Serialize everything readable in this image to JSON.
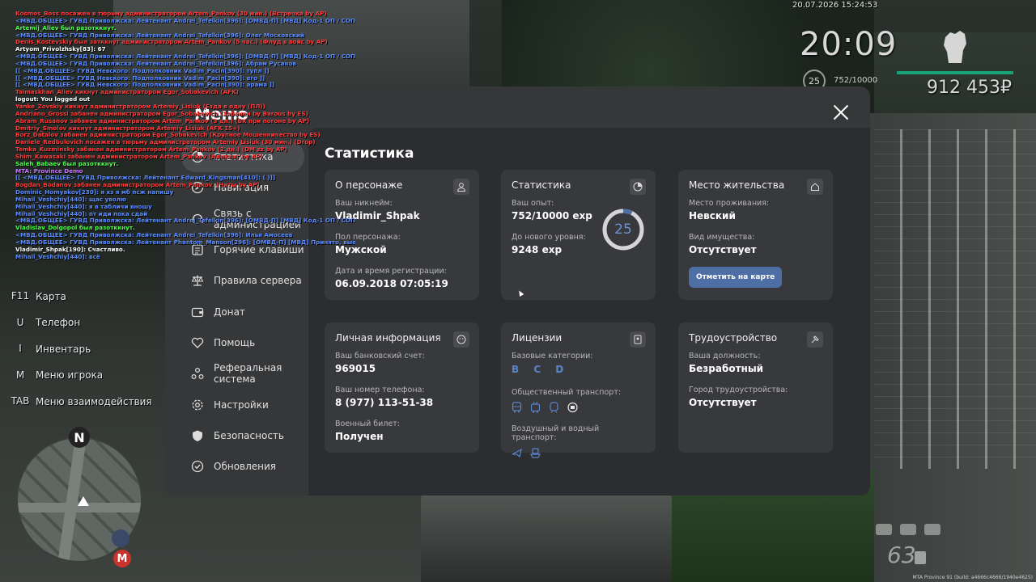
{
  "timestamp": "20.07.2026 15:24:53",
  "chat": [
    {
      "text": "Kosmos_Boss посажен в тюрьму администратором Artem_Pankov (30 мин.) (Встречка by AP)",
      "color": "#ff3b3b"
    },
    {
      "text": "<МВД.ОБЩЕЕ> ГУВД Приволжска: Лейтенант Andrei_Tefelkin[396]: [ОМВД-П] [МВД] Код-1 ОП / СОП по БД:",
      "color": "#5b8cff"
    },
    {
      "text": "Artemij_Aliev был разотккнут.",
      "color": "#4cff4c"
    },
    {
      "text": "<МВД.ОБЩЕЕ> ГУВД Приволжска: Лейтенант Andrei_Tefelkin[396]: Олег Московский",
      "color": "#5b8cff"
    },
    {
      "text": "Denis_Kostevskiy был затккнут администратором Artem_Pankov (5 час.) (Флуд в войс by AP)",
      "color": "#ff3b3b"
    },
    {
      "text": "Artyom_Privolzhsky[83]: 67",
      "color": "#ffffff"
    },
    {
      "text": "<МВД.ОБЩЕЕ> ГУВД Приволжска: Лейтенант Andrei_Tefelkin[396]: [ОМВД-П] [МВД] Код-1 ОП / СОП по БД:",
      "color": "#5b8cff"
    },
    {
      "text": "<МВД.ОБЩЕЕ> ГУВД Приволжска: Лейтенант Andrei_Tefelkin[396]: Абрам Русанов",
      "color": "#5b8cff"
    },
    {
      "text": "[[ <МВД.ОБЩЕЕ> ГУВД Невского: Подполковник Vadim_Pacin[390]: тупл ]]",
      "color": "#5b8cff"
    },
    {
      "text": "[[ <МВД.ОБЩЕЕ> ГУВД Невского: Подполковник Vadim_Pacin[390]: его ]]",
      "color": "#5b8cff"
    },
    {
      "text": "[[ <МВД.ОБЩЕЕ> ГУВД Невского: Подполковник Vadim_Pacin[390]: арама ]]",
      "color": "#5b8cff"
    },
    {
      "text": "Taimaskhan_Aliev кикнут администратором Egor_Sobakevich (AFK)",
      "color": "#ff3b3b"
    },
    {
      "text": "logout: You logged out",
      "color": "#ffffff"
    },
    {
      "text": "Yanke_Zovskiy кикнут администратором Artemiy_Lisiuk (Езда в одну (ПЛ))",
      "color": "#ff3b3b"
    },
    {
      "text": "Andriano_Grossi забанен администратором Egor_Sobakevich (Забанен by Barous by ES)",
      "color": "#ff3b3b"
    },
    {
      "text": "Abram_Rusanov забанен администратором Artem_Pankov (3 дн.) (БХ при погоне by AP)",
      "color": "#ff3b3b"
    },
    {
      "text": "Dmitriy_Smolov кикнут администратором Artemiy_Lisiuk (AFK 15+)",
      "color": "#ff3b3b"
    },
    {
      "text": "Borz_Datalov забанен администратором Egor_Sobakevich (Крупное Мошенничество by ES)",
      "color": "#ff3b3b"
    },
    {
      "text": "Daniele_Redbulovich посажен в тюрьму администратором Artemiy Lisiuk (30 мин.) (Drop)",
      "color": "#ff3b3b"
    },
    {
      "text": "Temka_Kuzminsky забанен администратором Artem_Pankov (2 дн.) (DM zz by AP)",
      "color": "#ff3b3b"
    },
    {
      "text": "Shim_Kawasaki забанен администратором Artem_Pankov (Адекват by AP)",
      "color": "#ff3b3b"
    },
    {
      "text": "Saleh_Babaev был разотккнут.",
      "color": "#4cff4c"
    },
    {
      "text": "MTA: Province Demo",
      "color": "#c77dff"
    },
    {
      "text": "[[ <МВД.ОБЩЕЕ> ГУВД Приволжска: Лейтенант Edward_Kingsman[410]: ( )]]",
      "color": "#5b8cff"
    },
    {
      "text": "Bogdan_Bodanov забанен администратором Artem_Pankov. (Читы by AP)",
      "color": "#ff3b3b"
    },
    {
      "text": "Dominic_Homyakov[230]: я хз я мб псж напишу",
      "color": "#5b8cff"
    },
    {
      "text": "Mihail_Veshchiy[440]: щас уволю",
      "color": "#5b8cff"
    },
    {
      "text": "Mihail_Veshchiy[440]: я в табличи вношу",
      "color": "#5b8cff"
    },
    {
      "text": "Mihail_Veshchiy[440]: пт иди пока сдай",
      "color": "#5b8cff"
    },
    {
      "text": "<МВД.ОБЩЕЕ> ГУВД Приволжска: Лейтенант Andrei_Tefelkin[396]: [ОМВД-П] [МВД] Код-1 ОП / СОП по БД:",
      "color": "#5b8cff"
    },
    {
      "text": "Vladislav_Dolgopol был разотккнут.",
      "color": "#4cff4c"
    },
    {
      "text": "<МВД.ОБЩЕЕ> ГУВД Приволжска: Лейтенант Andrei_Tefelkin[396]: Илья Амосеев",
      "color": "#5b8cff"
    },
    {
      "text": "<МВД.ОБЩЕЕ> ГУВД Приволжска: Лейтенант Phantom_Manson[296]: [ОМВД-П] [МВД] Принято, выезжаем.",
      "color": "#5b8cff"
    },
    {
      "text": "Vladimir_Shpak[190]: Счастливо.",
      "color": "#ffffff"
    },
    {
      "text": "Mihail_Veshchiy[440]: всё",
      "color": "#5b8cff"
    }
  ],
  "hud": {
    "clock": "20:09",
    "level": "25",
    "exp": "752/10000",
    "money": "912 453₽",
    "speed": "63",
    "build": "MTA Province 91 (build: a4666c4666/1940e4625)"
  },
  "hotkeys": [
    {
      "key": "F11",
      "label": "Карта"
    },
    {
      "key": "U",
      "label": "Телефон"
    },
    {
      "key": "I",
      "label": "Инвентарь"
    },
    {
      "key": "M",
      "label": "Меню игрока"
    },
    {
      "key": "TAB",
      "label": "Меню взаимодействия"
    }
  ],
  "minimap": {
    "north": "N",
    "metro": "М"
  },
  "menu": {
    "title": "Меню",
    "nav": [
      {
        "label": "Статистика",
        "icon": "stats-icon",
        "active": true
      },
      {
        "label": "Навигация",
        "icon": "compass-icon"
      },
      {
        "label": "Связь с администрацией",
        "icon": "headset-icon"
      },
      {
        "label": "Горячие клавиши",
        "icon": "keyboard-icon"
      },
      {
        "label": "Правила сервера",
        "icon": "scales-icon"
      },
      {
        "label": "Донат",
        "icon": "wallet-icon"
      },
      {
        "label": "Помощь",
        "icon": "heart-hands-icon"
      },
      {
        "label": "Реферальная система",
        "icon": "referral-icon"
      },
      {
        "label": "Настройки",
        "icon": "gear-icon"
      },
      {
        "label": "Безопасность",
        "icon": "shield-icon"
      },
      {
        "label": "Обновления",
        "icon": "check-circle-icon"
      }
    ],
    "content_title": "Статистика",
    "cards": {
      "person": {
        "title": "О персонаже",
        "nick_label": "Ваш никнейм:",
        "nick": "Vladimir_Shpak",
        "sex_label": "Пол персонажа:",
        "sex": "Мужской",
        "reg_label": "Дата и время регистрации:",
        "reg": "06.09.2018 07:05:19"
      },
      "stats": {
        "title": "Статистика",
        "exp_label": "Ваш опыт:",
        "exp": "752/10000 exp",
        "next_label": "До нового уровня:",
        "next": "9248 exp",
        "level": "25",
        "progress": 0.0752
      },
      "residence": {
        "title": "Место жительства",
        "place_label": "Место проживания:",
        "place": "Невский",
        "property_label": "Вид имущества:",
        "property": "Отсутствует",
        "map_button": "Отметить на карте"
      },
      "personal": {
        "title": "Личная информация",
        "bank_label": "Ваш банковский счет:",
        "bank": "969015",
        "phone_label": "Ваш номер телефона:",
        "phone": "8 (977) 113-51-38",
        "military_label": "Военный билет:",
        "military": "Получен"
      },
      "licenses": {
        "title": "Лицензии",
        "base_label": "Базовые категории:",
        "base": "B C D",
        "public_label": "Общественный транспорт:",
        "air_label": "Воздушный и водный транспорт:"
      },
      "employment": {
        "title": "Трудоустройство",
        "job_label": "Ваша должность:",
        "job": "Безработный",
        "city_label": "Город трудоустройства:",
        "city": "Отсутствует"
      }
    }
  }
}
